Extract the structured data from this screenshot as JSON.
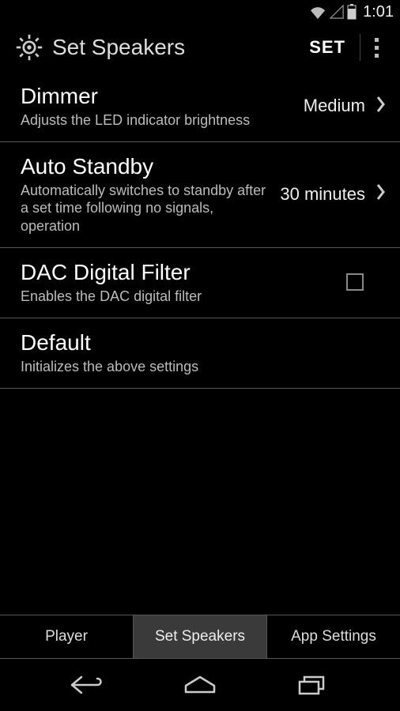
{
  "status": {
    "time": "1:01"
  },
  "header": {
    "title": "Set Speakers",
    "set_label": "SET"
  },
  "settings": {
    "dimmer": {
      "label": "Dimmer",
      "desc": "Adjusts the LED indicator brightness",
      "value": "Medium"
    },
    "auto_standby": {
      "label": "Auto Standby",
      "desc": "Automatically switches to standby after a set time following no signals, operation",
      "value": "30 minutes"
    },
    "dac_filter": {
      "label": "DAC Digital Filter",
      "desc": "Enables the DAC digital filter",
      "checked": false
    },
    "default": {
      "label": "Default",
      "desc": "Initializes the above settings"
    }
  },
  "tabs": {
    "player": "Player",
    "set_speakers": "Set Speakers",
    "app_settings": "App Settings",
    "active": "set_speakers"
  }
}
